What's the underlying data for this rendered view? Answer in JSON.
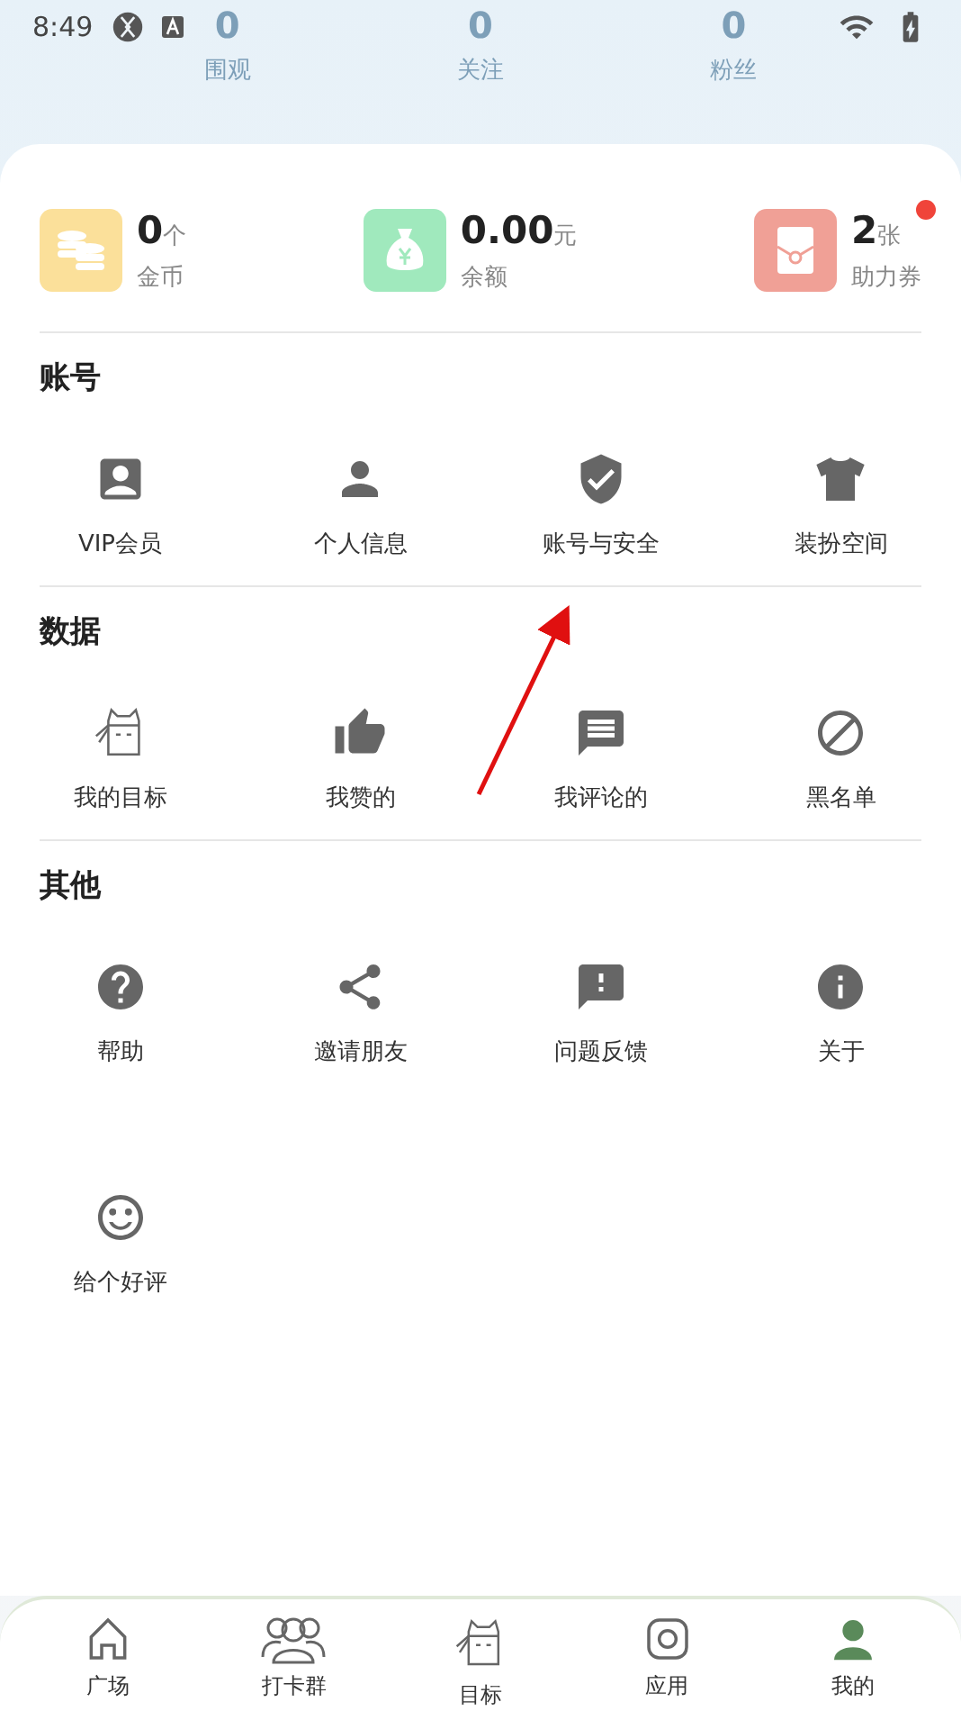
{
  "status_bar": {
    "time": "8:49"
  },
  "header_stats": [
    {
      "value": "0",
      "label": "围观"
    },
    {
      "value": "0",
      "label": "关注"
    },
    {
      "value": "0",
      "label": "粉丝"
    }
  ],
  "wallet": [
    {
      "value": "0",
      "unit": "个",
      "label": "金币",
      "color": "#fbe09a",
      "dot": false
    },
    {
      "value": "0.00",
      "unit": "元",
      "label": "余额",
      "color": "#a0e9bd",
      "dot": false
    },
    {
      "value": "2",
      "unit": "张",
      "label": "助力券",
      "color": "#f0a096",
      "dot": true
    }
  ],
  "sections": [
    {
      "title": "账号",
      "items": [
        "VIP会员",
        "个人信息",
        "账号与安全",
        "装扮空间"
      ]
    },
    {
      "title": "数据",
      "items": [
        "我的目标",
        "我赞的",
        "我评论的",
        "黑名单"
      ]
    },
    {
      "title": "其他",
      "items": [
        "帮助",
        "邀请朋友",
        "问题反馈",
        "关于",
        "给个好评"
      ]
    }
  ],
  "bottom_nav": [
    "广场",
    "打卡群",
    "目标",
    "应用",
    "我的"
  ]
}
